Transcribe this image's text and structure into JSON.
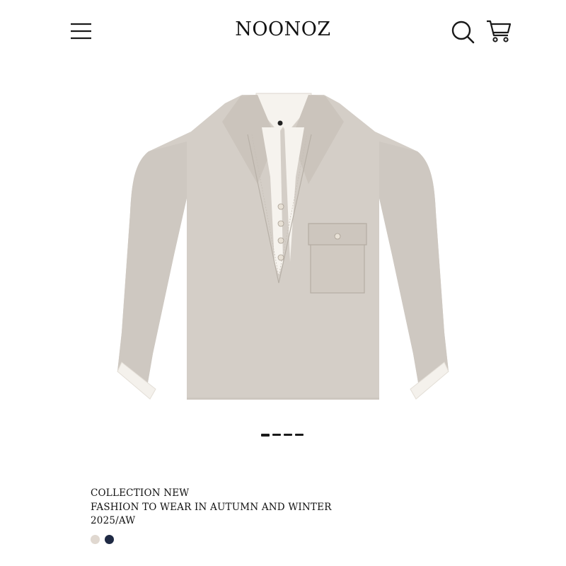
{
  "header": {
    "brand": "NOONOZ",
    "icons": [
      "menu-icon",
      "search-icon",
      "cart-icon"
    ]
  },
  "product": {
    "image_icon": "shirt-image",
    "carousel": {
      "count": 4,
      "active": 0
    }
  },
  "info": {
    "line1": "COLLECTION NEW",
    "line2": "FASHION TO WEAR IN AUTUMN AND WINTER",
    "line3": "2025/AW"
  },
  "swatches": [
    {
      "name": "beige",
      "color": "#e0d8d0"
    },
    {
      "name": "navy",
      "color": "#1f2a44"
    }
  ]
}
